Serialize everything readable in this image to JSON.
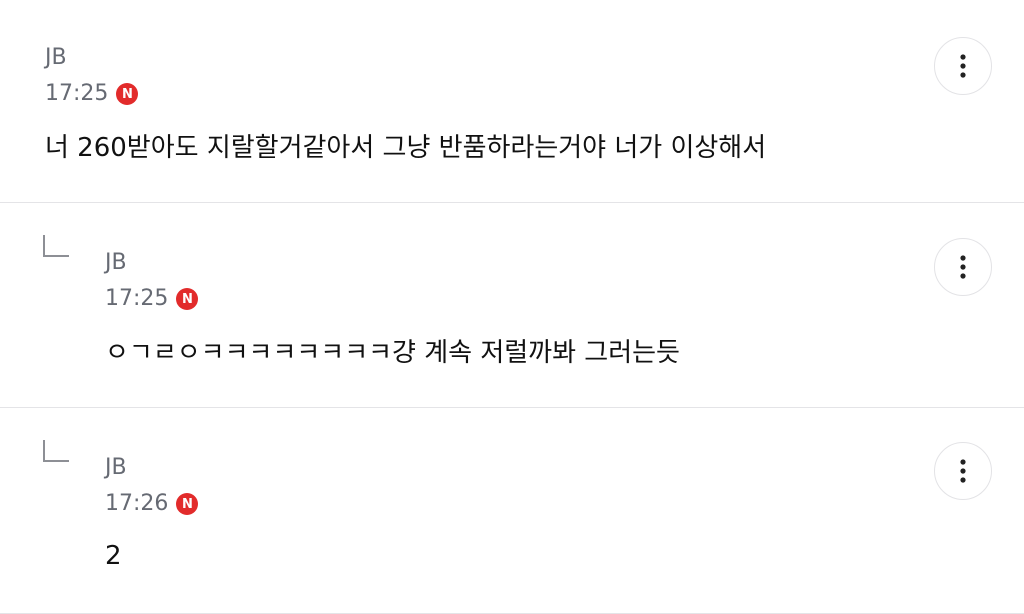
{
  "comments": [
    {
      "author": "JB",
      "time": "17:25",
      "new_badge": "N",
      "text": "너 260받아도 지랄할거같아서 그냥 반품하라는거야 너가 이상해서",
      "is_reply": false
    },
    {
      "author": "JB",
      "time": "17:25",
      "new_badge": "N",
      "text": "ㅇㄱㄹㅇㅋㅋㅋㅋㅋㅋㅋㅋ걍 계속 저럴까봐 그러는듯",
      "is_reply": true
    },
    {
      "author": "JB",
      "time": "17:26",
      "new_badge": "N",
      "text": "2",
      "is_reply": true
    }
  ],
  "icons": {
    "reply": "reply-arrow-icon",
    "more": "more-vertical-icon"
  },
  "colors": {
    "badge": "#e22b2b",
    "meta_text": "#666a73",
    "body_text": "#111111",
    "divider": "#e4e4e7"
  }
}
